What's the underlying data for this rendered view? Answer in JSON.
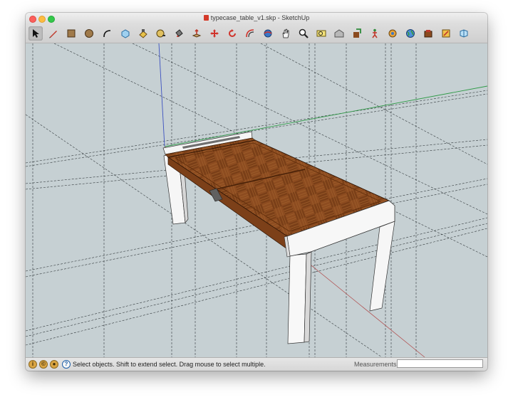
{
  "window": {
    "title": "typecase_table_v1.skp - SketchUp"
  },
  "toolbar": {
    "tools": [
      {
        "name": "select",
        "icon": "arrow-cursor-icon",
        "active": true
      },
      {
        "name": "line",
        "icon": "pencil-icon"
      },
      {
        "name": "rectangle",
        "icon": "rectangle-icon"
      },
      {
        "name": "circle",
        "icon": "circle-icon"
      },
      {
        "name": "arc",
        "icon": "arc-icon"
      },
      {
        "name": "make-component",
        "icon": "component-icon"
      },
      {
        "name": "eraser",
        "icon": "eraser-icon"
      },
      {
        "name": "tape-measure",
        "icon": "tape-measure-icon"
      },
      {
        "name": "paint-bucket",
        "icon": "paint-bucket-icon"
      },
      {
        "name": "push-pull",
        "icon": "push-pull-icon"
      },
      {
        "name": "move",
        "icon": "move-icon"
      },
      {
        "name": "rotate",
        "icon": "rotate-icon"
      },
      {
        "name": "offset",
        "icon": "offset-icon"
      },
      {
        "name": "orbit",
        "icon": "orbit-icon"
      },
      {
        "name": "pan",
        "icon": "hand-pan-icon"
      },
      {
        "name": "zoom",
        "icon": "zoom-icon"
      },
      {
        "name": "zoom-extents",
        "icon": "zoom-extents-icon"
      },
      {
        "name": "warehouse",
        "icon": "warehouse-icon"
      },
      {
        "name": "share-model",
        "icon": "share-model-icon"
      },
      {
        "name": "walk",
        "icon": "walk-icon"
      },
      {
        "name": "position-camera",
        "icon": "position-camera-icon"
      },
      {
        "name": "add-location",
        "icon": "globe-icon"
      },
      {
        "name": "extension-warehouse",
        "icon": "extension-icon"
      },
      {
        "name": "layout",
        "icon": "layout-icon"
      },
      {
        "name": "style-builder",
        "icon": "style-builder-icon"
      }
    ]
  },
  "statusbar": {
    "message": "Select objects. Shift to extend select. Drag mouse to select multiple.",
    "measurements_label": "Measurements",
    "measurements_value": ""
  },
  "colors": {
    "viewport_bg": "#c6d0d3",
    "wood": "#8b4a1f",
    "leg": "#f4f4f4"
  }
}
